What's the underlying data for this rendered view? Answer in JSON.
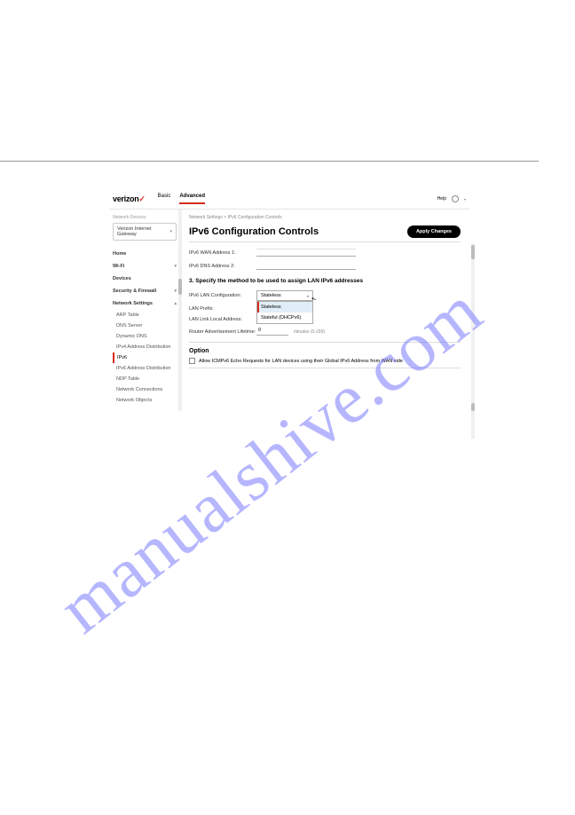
{
  "watermark": "manualshive.com",
  "header": {
    "brand": "verizon",
    "tabs": {
      "basic": "Basic",
      "advanced": "Advanced"
    },
    "right": {
      "help": "Help"
    }
  },
  "sidebar": {
    "label": "Network Devices",
    "device": "Verizon Internet Gateway",
    "items": {
      "home": "Home",
      "wifi": "Wi-Fi",
      "devices": "Devices",
      "security": "Security & Firewall",
      "network": "Network Settings"
    },
    "subs": {
      "arp": "ARP Table",
      "dns": "DNS Server",
      "ddns": "Dynamic DNS",
      "ipv4": "IPv4 Address Distribution",
      "ipv6": "IPv6",
      "ipv6dist": "IPv6 Address Distribution",
      "ndp": "NDP Table",
      "netconn": "Network Connections",
      "netobj": "Network Objects"
    }
  },
  "main": {
    "breadcrumb": "Network Settings  >  IPv6 Configuration Controls",
    "title": "IPv6 Configuration Controls",
    "apply": "Apply Changes",
    "rows": {
      "addr1": "IPv6 WAN Address 1:",
      "addr2": "IPv6 DNS Address 2:",
      "sectionH": "3. Specify the method to be used to assign LAN IPv6 addresses",
      "lanConfig": "IPv6 LAN Configuration:",
      "lanPrefix": "LAN Prefix:",
      "lanLink": "LAN Link Local Address:",
      "routerAd": "Router Advertisement Lifetime:",
      "routerVal": "0",
      "routerUnit": "minutes (0-150)"
    },
    "dd": {
      "selected": "Stateless",
      "opt1": "Stateless",
      "opt2": "Stateful (DHCPv6)"
    },
    "option": {
      "h": "Option",
      "text": "Allow ICMPv6 Echo Requests for LAN devices using their Global IPv6 Address from WAN side"
    }
  }
}
